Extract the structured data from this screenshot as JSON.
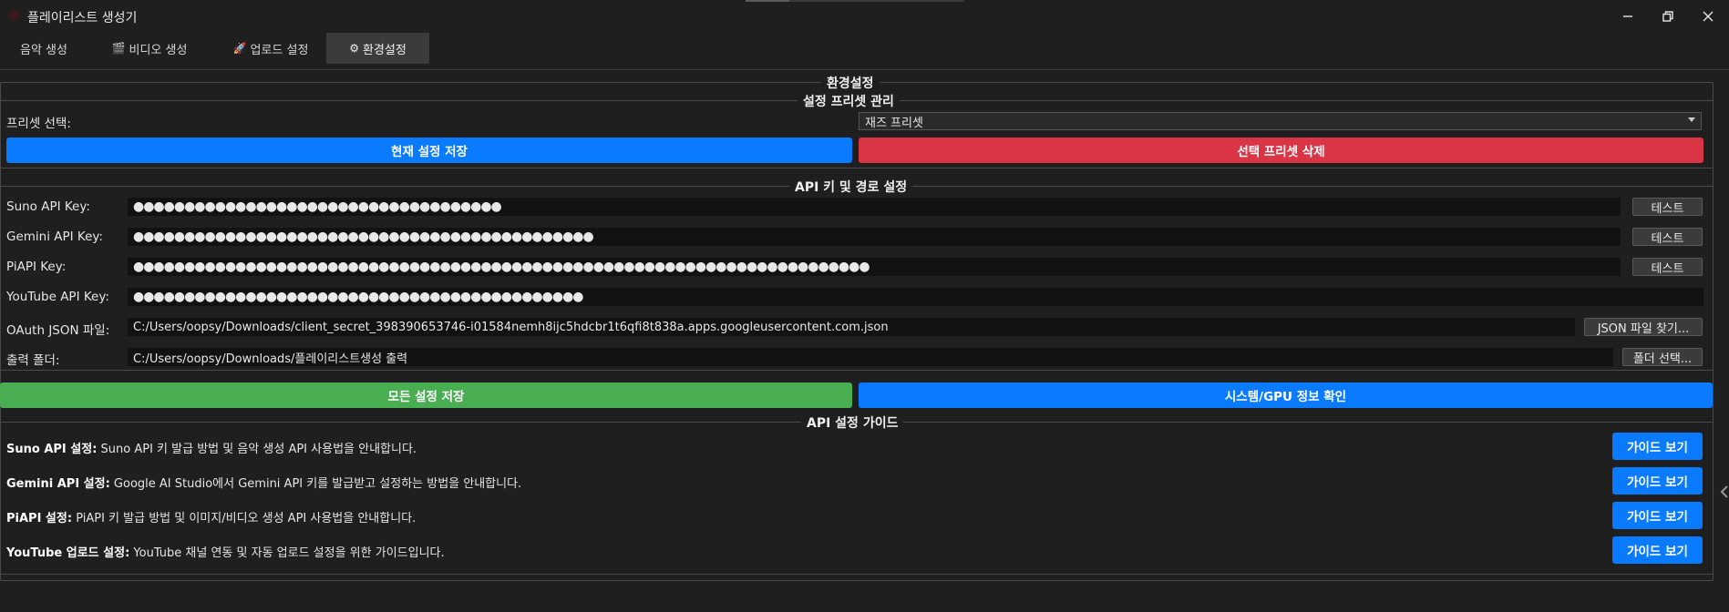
{
  "window": {
    "title": "플레이리스트 생성기"
  },
  "tabs": [
    {
      "label": "음악 생성",
      "icon": ""
    },
    {
      "label": "비디오 생성",
      "icon": "🎬"
    },
    {
      "label": "업로드 설정",
      "icon": "🚀"
    },
    {
      "label": "환경설정",
      "icon": "⚙"
    }
  ],
  "page": {
    "title": "환경설정"
  },
  "preset": {
    "group_title": "설정 프리셋 관리",
    "label": "프리셋 선택:",
    "selected": "재즈 프리셋",
    "save_label": "현재 설정 저장",
    "delete_label": "선택 프리셋 삭제"
  },
  "api": {
    "group_title": "API 키 및 경로 설정",
    "rows": [
      {
        "label": "Suno API Key:",
        "value": "●●●●●●●●●●●●●●●●●●●●●●●●●●●●●●●●●●●●",
        "button": "테스트"
      },
      {
        "label": "Gemini API Key:",
        "value": "●●●●●●●●●●●●●●●●●●●●●●●●●●●●●●●●●●●●●●●●●●●●●",
        "button": "테스트"
      },
      {
        "label": "PiAPI Key:",
        "value": "●●●●●●●●●●●●●●●●●●●●●●●●●●●●●●●●●●●●●●●●●●●●●●●●●●●●●●●●●●●●●●●●●●●●●●●●",
        "button": "테스트"
      },
      {
        "label": "YouTube API Key:",
        "value": "●●●●●●●●●●●●●●●●●●●●●●●●●●●●●●●●●●●●●●●●●●●●"
      }
    ],
    "oauth": {
      "label": "OAuth JSON 파일:",
      "value": "C:/Users/oopsy/Downloads/client_secret_398390653746-i01584nemh8ijc5hdcbr1t6qfi8t838a.apps.googleusercontent.com.json",
      "button": "JSON 파일 찾기..."
    },
    "output": {
      "label": "출력 폴더:",
      "value": "C:/Users/oopsy/Downloads/플레이리스트생성 출력",
      "button": "폴더 선택..."
    }
  },
  "actions": {
    "save_all": "모든 설정 저장",
    "system_info": "시스템/GPU 정보 확인"
  },
  "guide": {
    "group_title": "API 설정 가이드",
    "items": [
      {
        "title": "Suno API 설정:",
        "desc": " Suno API 키 발급 방법 및 음악 생성 API 사용법을 안내합니다.",
        "button": "가이드 보기"
      },
      {
        "title": "Gemini API 설정:",
        "desc": " Google AI Studio에서 Gemini API 키를 발급받고 설정하는 방법을 안내합니다.",
        "button": "가이드 보기"
      },
      {
        "title": "PiAPI 설정:",
        "desc": " PiAPI 키 발급 방법 및 이미지/비디오 생성 API 사용법을 안내합니다.",
        "button": "가이드 보기"
      },
      {
        "title": "YouTube 업로드 설정:",
        "desc": " YouTube 채널 연동 및 자동 업로드 설정을 위한 가이드입니다.",
        "button": "가이드 보기"
      }
    ]
  },
  "colors": {
    "background": "#1f1f1f",
    "blue": "#0a7bff",
    "red": "#d93545",
    "green": "#49ad51"
  }
}
